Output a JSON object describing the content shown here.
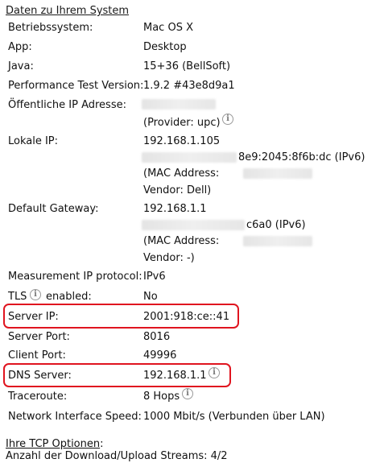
{
  "section_title": "Daten zu Ihrem System",
  "rows": {
    "os": {
      "label": "Betriebssystem:",
      "value": "Mac OS X"
    },
    "app": {
      "label": "App:",
      "value": "Desktop"
    },
    "java": {
      "label": "Java:",
      "value": "15+36 (BellSoft)"
    },
    "perf": {
      "label": "Performance Test Version:",
      "value": "1.9.2 #43e8d9a1"
    },
    "public_ip": {
      "label": "Öffentliche IP Adresse:",
      "provider": "(Provider: upc)"
    },
    "local_ip": {
      "label": "Lokale IP:",
      "value": "192.168.1.105",
      "ipv6_suffix": "8e9:2045:8f6b:dc (IPv6)",
      "mac_label": "(MAC Address:",
      "vendor": "Vendor: Dell)"
    },
    "gateway": {
      "label": "Default Gateway:",
      "value": "192.168.1.1",
      "ipv6_suffix": "c6a0 (IPv6)",
      "mac_label": "(MAC Address:",
      "vendor": "Vendor: -)"
    },
    "measurement": {
      "label": "Measurement IP protocol:",
      "value": "IPv6"
    },
    "tls": {
      "label_pre": "TLS",
      "label_post": "enabled:",
      "value": "No"
    },
    "server_ip": {
      "label": "Server IP:",
      "value": "2001:918:ce::41"
    },
    "server_port": {
      "label": "Server Port:",
      "value": "8016"
    },
    "client_port": {
      "label": "Client Port:",
      "value": "49996"
    },
    "dns": {
      "label": "DNS Server:",
      "value": "192.168.1.1"
    },
    "traceroute": {
      "label": "Traceroute:",
      "value": "8 Hops"
    },
    "nic_speed": {
      "label": "Network Interface Speed:",
      "value": "1000 Mbit/s (Verbunden über LAN)"
    }
  },
  "tcp": {
    "heading": "Ihre TCP Optionen",
    "colon": ":",
    "streams": "Anzahl der Download/Upload Streams: 4/2"
  },
  "icons": {
    "info": "info-icon"
  },
  "colors": {
    "highlight": "#e0141f",
    "redacted": "#e6e6e6"
  }
}
